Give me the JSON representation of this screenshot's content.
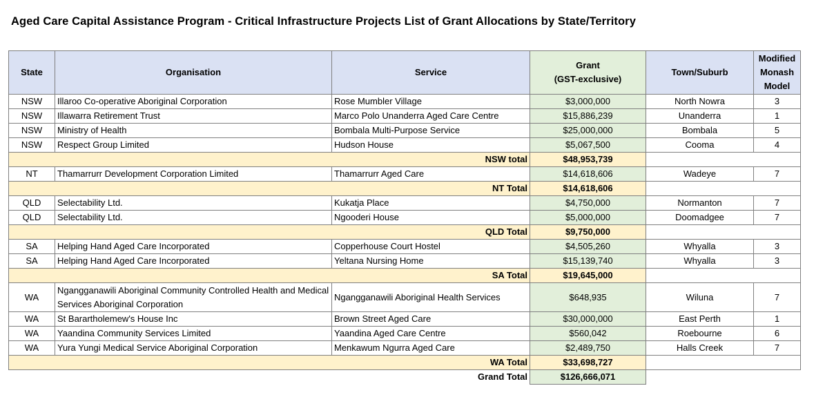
{
  "title": "Aged Care Capital Assistance Program - Critical Infrastructure Projects List of Grant Allocations by State/Territory",
  "headers": {
    "state": "State",
    "organisation": "Organisation",
    "service": "Service",
    "grant_line1": "Grant",
    "grant_line2": "(GST-exclusive)",
    "town": "Town/Suburb",
    "mmm_line1": "Modified",
    "mmm_line2": "Monash",
    "mmm_line3": "Model"
  },
  "rows": [
    {
      "state": "NSW",
      "organisation": "Illaroo Co-operative Aboriginal Corporation",
      "service": "Rose Mumbler Village",
      "grant": "$3,000,000",
      "town": "North Nowra",
      "mmm": "3"
    },
    {
      "state": "NSW",
      "organisation": "Illawarra Retirement Trust",
      "service": "Marco Polo Unanderra Aged Care Centre",
      "grant": "$15,886,239",
      "town": "Unanderra",
      "mmm": "1"
    },
    {
      "state": "NSW",
      "organisation": "Ministry of Health",
      "service": "Bombala Multi-Purpose Service",
      "grant": "$25,000,000",
      "town": "Bombala",
      "mmm": "5"
    },
    {
      "state": "NSW",
      "organisation": "Respect Group Limited",
      "service": "Hudson House",
      "grant": "$5,067,500",
      "town": "Cooma",
      "mmm": "4"
    },
    {
      "subtotal_label": "NSW total",
      "subtotal_value": "$48,953,739"
    },
    {
      "state": "NT",
      "organisation": "Thamarrurr Development Corporation Limited",
      "service": "Thamarrurr Aged Care",
      "grant": "$14,618,606",
      "town": "Wadeye",
      "mmm": "7"
    },
    {
      "subtotal_label": "NT Total",
      "subtotal_value": "$14,618,606"
    },
    {
      "state": "QLD",
      "organisation": "Selectability Ltd.",
      "service": "Kukatja Place",
      "grant": "$4,750,000",
      "town": "Normanton",
      "mmm": "7"
    },
    {
      "state": "QLD",
      "organisation": "Selectability Ltd.",
      "service": "Ngooderi House",
      "grant": "$5,000,000",
      "town": "Doomadgee",
      "mmm": "7"
    },
    {
      "subtotal_label": "QLD Total",
      "subtotal_value": "$9,750,000"
    },
    {
      "state": "SA",
      "organisation": "Helping Hand Aged Care Incorporated",
      "service": "Copperhouse Court Hostel",
      "grant": "$4,505,260",
      "town": "Whyalla",
      "mmm": "3"
    },
    {
      "state": "SA",
      "organisation": "Helping Hand Aged Care Incorporated",
      "service": "Yeltana Nursing Home",
      "grant": "$15,139,740",
      "town": "Whyalla",
      "mmm": "3"
    },
    {
      "subtotal_label": "SA Total",
      "subtotal_value": "$19,645,000"
    },
    {
      "state": "WA",
      "organisation": "Ngangganawili Aboriginal Community Controlled Health and Medical Services Aboriginal Corporation",
      "service": "Ngangganawili Aboriginal Health Services",
      "grant": "$648,935",
      "town": "Wiluna",
      "mmm": "7",
      "tall": true
    },
    {
      "state": "WA",
      "organisation": "St Barartholemew's House Inc",
      "service": "Brown Street Aged Care",
      "grant": "$30,000,000",
      "town": "East Perth",
      "mmm": "1"
    },
    {
      "state": "WA",
      "organisation": "Yaandina Community Services Limited",
      "service": "Yaandina Aged Care Centre",
      "grant": "$560,042",
      "town": "Roebourne",
      "mmm": "6"
    },
    {
      "state": "WA",
      "organisation": "Yura Yungi Medical Service Aboriginal Corporation",
      "service": "Menkawum Ngurra Aged Care",
      "grant": "$2,489,750",
      "town": "Halls Creek",
      "mmm": "7"
    },
    {
      "subtotal_label": "WA Total",
      "subtotal_value": "$33,698,727"
    }
  ],
  "grand_total": {
    "label": "Grand Total",
    "value": "$126,666,071"
  },
  "colors": {
    "header_bg": "#dae1f3",
    "grant_bg": "#e2efda",
    "subtotal_bg": "#fff2cc",
    "border": "#7f7f7f"
  }
}
